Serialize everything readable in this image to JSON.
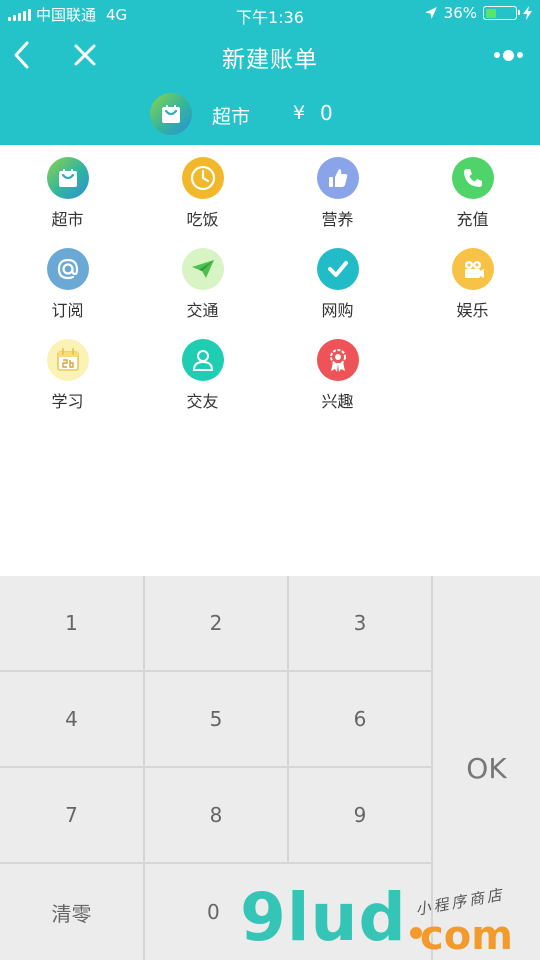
{
  "status_bar": {
    "carrier": "中国联通",
    "network": "4G",
    "time": "下午1:36",
    "battery_percent": "36%",
    "battery_level": 0.36
  },
  "nav": {
    "title": "新建账单",
    "back_icon": "chevron-left-icon",
    "close_icon": "close-icon",
    "more_icon": "more-dots-icon"
  },
  "summary": {
    "label": "超市",
    "currency": "¥",
    "amount": "0",
    "icon": "shopping-bag-icon"
  },
  "categories": [
    {
      "label": "超市",
      "icon": "shopping-bag-icon",
      "color": "#3cb8a8"
    },
    {
      "label": "吃饭",
      "icon": "clock-icon",
      "color": "#f0b82a"
    },
    {
      "label": "营养",
      "icon": "thumbs-up-icon",
      "color": "#8aa4ea"
    },
    {
      "label": "充值",
      "icon": "phone-icon",
      "color": "#4fd46a"
    },
    {
      "label": "订阅",
      "icon": "at-icon",
      "color": "#6aa8d6"
    },
    {
      "label": "交通",
      "icon": "paper-plane-icon",
      "color": "#d8f3c4"
    },
    {
      "label": "网购",
      "icon": "checkmark-icon",
      "color": "#22bcc8"
    },
    {
      "label": "娱乐",
      "icon": "projector-icon",
      "color": "#f8c246"
    },
    {
      "label": "学习",
      "icon": "calendar-icon",
      "color": "#fbf3b6"
    },
    {
      "label": "交友",
      "icon": "person-icon",
      "color": "#1ecdb2"
    },
    {
      "label": "兴趣",
      "icon": "badge-icon",
      "color": "#ee5457"
    }
  ],
  "keypad": {
    "keys": [
      "1",
      "2",
      "3",
      "4",
      "5",
      "6",
      "7",
      "8",
      "9",
      "清零",
      "0"
    ],
    "ok": "OK"
  },
  "watermark": {
    "main": "9lud",
    "domain": "com",
    "tagline": "小程序商店"
  },
  "colors": {
    "header": "#24c3c9",
    "key_bg": "#ececec",
    "key_grid": "#d6d6d6"
  }
}
